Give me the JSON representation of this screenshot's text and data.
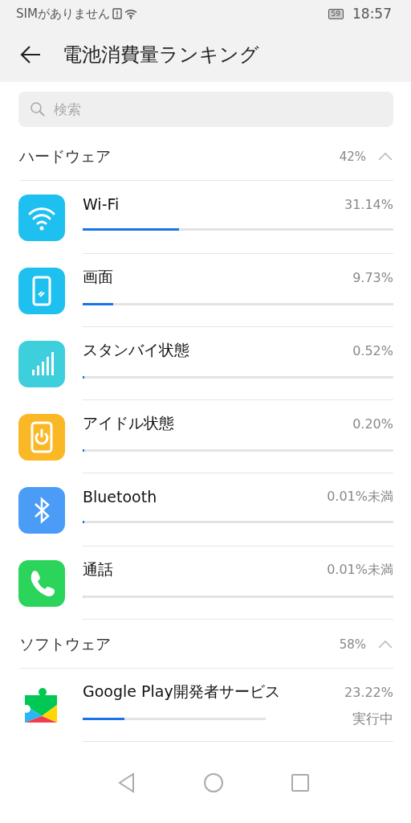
{
  "status_bar": {
    "carrier": "SIMがありません",
    "battery": "59",
    "time": "18:57"
  },
  "header": {
    "title": "電池消費量ランキング"
  },
  "search": {
    "placeholder": "検索"
  },
  "sections": [
    {
      "title": "ハードウェア",
      "percent": "42%",
      "expanded": true,
      "items": [
        {
          "name": "Wi-Fi",
          "value": "31.14%",
          "level": 0.31,
          "kind": "wifi",
          "color": "#1ec0f0"
        },
        {
          "name": "画面",
          "value": "9.73%",
          "level": 0.097,
          "kind": "screen",
          "color": "#1ec0f0"
        },
        {
          "name": "スタンバイ状態",
          "value": "0.52%",
          "level": 0.005,
          "kind": "signal",
          "color": "#3dcfdc"
        },
        {
          "name": "アイドル状態",
          "value": "0.20%",
          "level": 0.002,
          "kind": "power",
          "color": "#fbb826"
        },
        {
          "name": "Bluetooth",
          "value": "0.01%未満",
          "level": 0.001,
          "kind": "bluetooth",
          "color": "#4a9cf7"
        },
        {
          "name": "通話",
          "value": "0.01%未満",
          "level": 0.0,
          "kind": "phone",
          "color": "#2bd45a"
        }
      ]
    },
    {
      "title": "ソフトウェア",
      "percent": "58%",
      "expanded": true,
      "items": [
        {
          "name": "Google Play開発者サービス",
          "value": "23.22%",
          "status": "実行中",
          "level": 0.23,
          "kind": "puzzle"
        }
      ]
    }
  ]
}
